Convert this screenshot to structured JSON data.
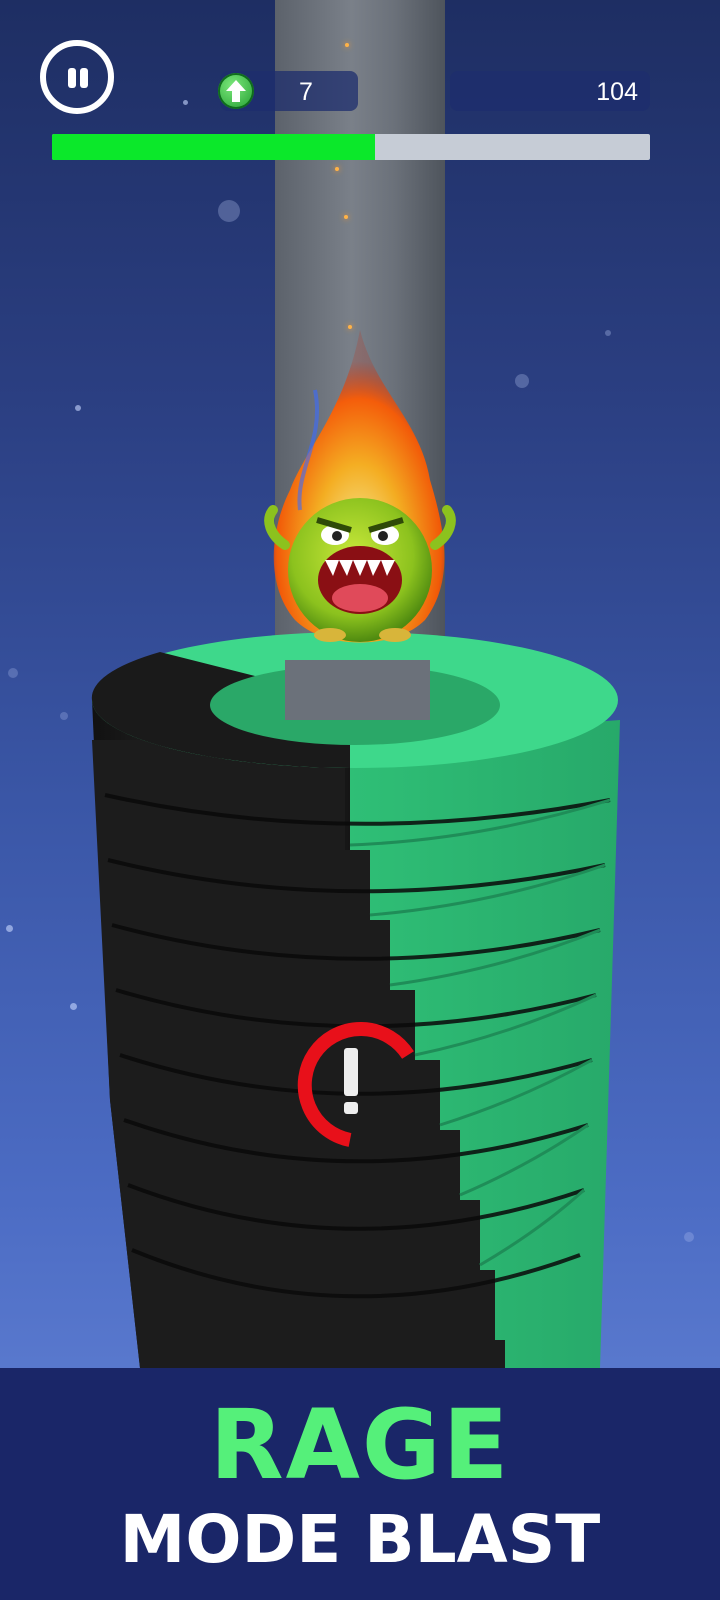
{
  "hud": {
    "pause_icon": "pause-icon",
    "level_icon": "green-up-arrow-icon",
    "level": "7",
    "score": "104",
    "progress_fraction": 0.54
  },
  "scene": {
    "character": "fire-monster",
    "warning_icon": "exclamation-icon"
  },
  "banner": {
    "title": "RAGE",
    "subtitle": "MODE BLAST"
  },
  "colors": {
    "progress_fill": "#0be82a",
    "ring_green": "#3ed88b",
    "ring_black": "#1a1a1a",
    "banner_bg": "#1a2668",
    "banner_title": "#55f07a"
  }
}
